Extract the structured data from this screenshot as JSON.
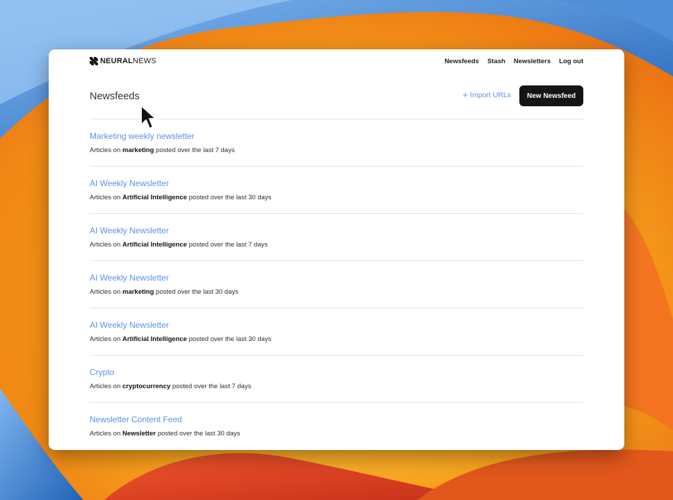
{
  "brand": {
    "name_bold": "NEURAL",
    "name_light": "NEWS"
  },
  "nav": {
    "items": [
      {
        "label": "Newsfeeds"
      },
      {
        "label": "Stash"
      },
      {
        "label": "Newsletters"
      },
      {
        "label": "Log out"
      }
    ]
  },
  "page": {
    "title": "Newsfeeds",
    "import_label": "Import URLs",
    "new_button_label": "New Newsfeed"
  },
  "feeds": [
    {
      "title": "Marketing weekly newsletter",
      "prefix": "Articles on",
      "topic": "marketing",
      "suffix": "posted over the last 7 days"
    },
    {
      "title": "AI Weekly Newsletter",
      "prefix": "Articles on",
      "topic": "Artificial Intelligence",
      "suffix": "posted over the last 30 days"
    },
    {
      "title": "AI Weekly Newsletter",
      "prefix": "Articles on",
      "topic": "Artificial Intelligence",
      "suffix": "posted over the last 7 days"
    },
    {
      "title": "AI Weekly Newsletter",
      "prefix": "Articles on",
      "topic": "marketing",
      "suffix": "posted over the last 30 days"
    },
    {
      "title": "AI Weekly Newsletter",
      "prefix": "Articles on",
      "topic": "Artificial Intelligence",
      "suffix": "posted over the last 30 days"
    },
    {
      "title": "Crypto",
      "prefix": "Articles on",
      "topic": "cryptocurrency",
      "suffix": "posted over the last 7 days"
    },
    {
      "title": "Newsletter Content Feed",
      "prefix": "Articles on",
      "topic": "Newsletter",
      "suffix": "posted over the last 30 days"
    }
  ],
  "colors": {
    "link": "#5b8ff0",
    "button_bg": "#141414",
    "wallpaper_orange": "#f6a21a",
    "wallpaper_blue": "#2f78c9"
  },
  "icons": {
    "logo": "neuralnews-logo-icon",
    "import": "plus-icon",
    "cursor": "arrow-cursor-icon"
  }
}
